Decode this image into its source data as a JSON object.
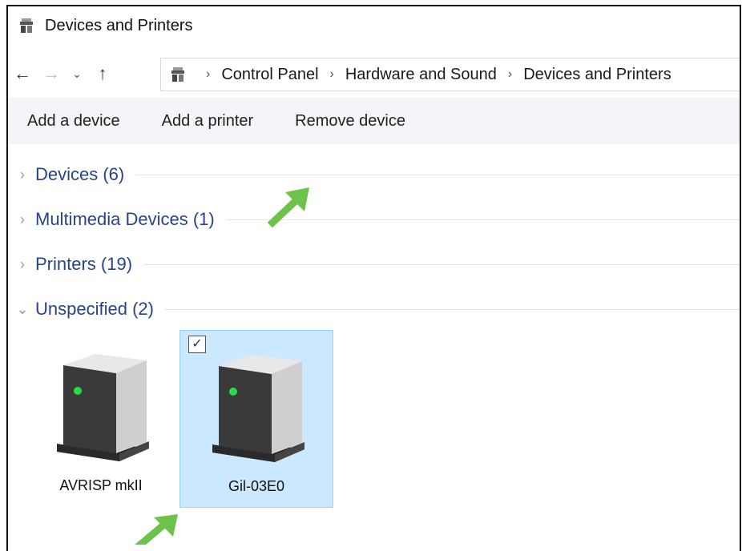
{
  "window": {
    "title": "Devices and Printers"
  },
  "nav": {
    "back_icon": "←",
    "forward_icon": "→",
    "recent_icon": "⌄",
    "up_icon": "↑",
    "separator": "›",
    "breadcrumbs": [
      "Control Panel",
      "Hardware and Sound",
      "Devices and Printers"
    ]
  },
  "commands": {
    "add_device": "Add a device",
    "add_printer": "Add a printer",
    "remove_device": "Remove device"
  },
  "groups": [
    {
      "title": "Devices (6)",
      "chevron": "›",
      "expanded": false
    },
    {
      "title": "Multimedia Devices (1)",
      "chevron": "›",
      "expanded": false
    },
    {
      "title": "Printers (19)",
      "chevron": "›",
      "expanded": false
    },
    {
      "title": "Unspecified (2)",
      "chevron": "⌄",
      "expanded": true
    }
  ],
  "devices": [
    {
      "label": "AVRISP mkII",
      "selected": false,
      "icon": "computer-tower-icon"
    },
    {
      "label": "Gil-03E0",
      "selected": true,
      "check": "✓",
      "icon": "computer-tower-icon"
    }
  ],
  "colors": {
    "selection_bg": "#cce8ff",
    "group_title": "#27448a",
    "annotation_arrow": "#6cc24a",
    "led": "#22dd44"
  }
}
